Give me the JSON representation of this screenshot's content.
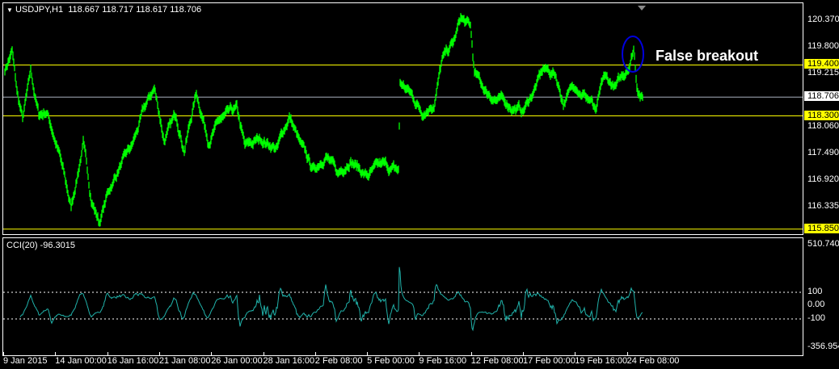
{
  "header": {
    "symbol": "USDJPY,H1",
    "ohlc": "118.667 118.717 118.617 118.706"
  },
  "indicator": {
    "label": "CCI(20) -96.3015"
  },
  "annotation": "False breakout",
  "colors": {
    "price": "#00ff00",
    "cci": "#20b2aa",
    "level": "#ffff00",
    "current": "#a9b0bd",
    "ellipse": "#0000dd"
  },
  "price_axis": {
    "ticks": [
      "120.370",
      "119.800",
      "119.215",
      "118.060",
      "117.490",
      "116.920",
      "116.335"
    ],
    "tags": {
      "r1": "119.400",
      "current": "118.706",
      "r2": "118.300",
      "s1": "115.850"
    }
  },
  "cci_axis": {
    "ticks": [
      "510.7409",
      "100",
      "0.00",
      "-100",
      "-356.9542"
    ]
  },
  "time_axis": [
    "9 Jan 2015",
    "14 Jan 00:00",
    "16 Jan 16:00",
    "21 Jan 08:00",
    "26 Jan 00:00",
    "28 Jan 16:00",
    "2 Feb 08:00",
    "5 Feb 00:00",
    "9 Feb 16:00",
    "12 Feb 08:00",
    "17 Feb 00:00",
    "19 Feb 16:00",
    "24 Feb 08:00"
  ],
  "chart_data": {
    "type": "line",
    "title": "USDJPY,H1",
    "ylim": [
      115.76,
      120.6
    ],
    "levels": [
      119.4,
      118.3,
      115.85
    ],
    "current": 118.706,
    "bars": [
      0,
      9,
      15,
      22,
      32,
      42,
      52,
      67,
      82,
      97,
      107,
      117,
      127,
      142,
      157,
      172,
      185,
      197,
      212,
      222,
      237,
      252,
      267,
      287,
      297,
      317,
      337,
      352,
      367,
      382,
      397,
      412,
      427,
      447,
      467,
      487,
      489,
      501,
      516,
      531,
      541,
      556,
      564,
      576,
      581,
      596,
      616,
      641,
      656,
      666,
      681,
      691,
      706,
      726,
      731,
      741,
      756,
      766,
      774,
      778,
      782,
      789
    ],
    "prices": [
      119.3,
      119.7,
      118.8,
      118.2,
      119.2,
      118.3,
      118.4,
      117.5,
      116.3,
      117.7,
      116.5,
      116.0,
      116.6,
      117.2,
      117.6,
      118.4,
      118.9,
      117.8,
      118.3,
      117.6,
      118.8,
      117.8,
      118.2,
      118.4,
      117.6,
      117.8,
      117.6,
      118.3,
      117.6,
      117.1,
      117.5,
      117.0,
      117.4,
      117.0,
      117.2,
      117.1,
      119.0,
      118.8,
      118.4,
      118.6,
      119.5,
      119.9,
      120.4,
      120.2,
      119.2,
      118.8,
      118.6,
      118.4,
      118.9,
      119.3,
      119.2,
      118.6,
      119.0,
      118.6,
      118.3,
      119.1,
      118.9,
      119.2,
      119.5,
      119.8,
      119.0,
      118.706
    ]
  }
}
